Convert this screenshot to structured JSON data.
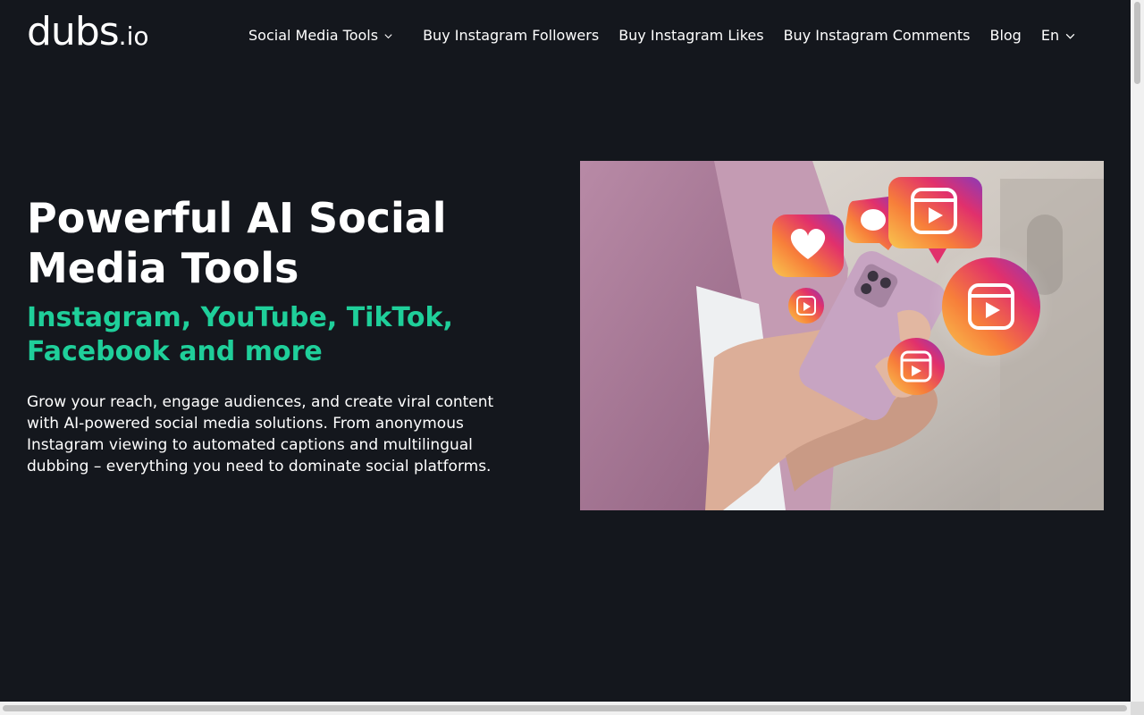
{
  "header": {
    "logo_main": "dubs",
    "logo_sub": ".io",
    "nav": [
      {
        "label": "Social Media Tools",
        "has_dropdown": true
      },
      {
        "label": "Buy Instagram Followers",
        "has_dropdown": false
      },
      {
        "label": "Buy Instagram Likes",
        "has_dropdown": false
      },
      {
        "label": "Buy Instagram Comments",
        "has_dropdown": false
      },
      {
        "label": "Blog",
        "has_dropdown": false
      },
      {
        "label": "En",
        "has_dropdown": true
      }
    ]
  },
  "hero": {
    "title": "Powerful AI Social Media Tools",
    "subtitle": "Instagram, YouTube, TikTok, Facebook and more",
    "description": "Grow your reach, engage audiences, and create viral content with AI-powered social media solutions. From anonymous Instagram viewing to automated captions and multilingual dubbing – everything you need to dominate social platforms.",
    "image_icons": [
      "heart-icon",
      "comment-icon",
      "reels-icon",
      "reels-icon",
      "reels-icon",
      "reels-icon"
    ]
  },
  "colors": {
    "background": "#14171d",
    "accent": "#1fcf9a",
    "text": "#ffffff"
  }
}
